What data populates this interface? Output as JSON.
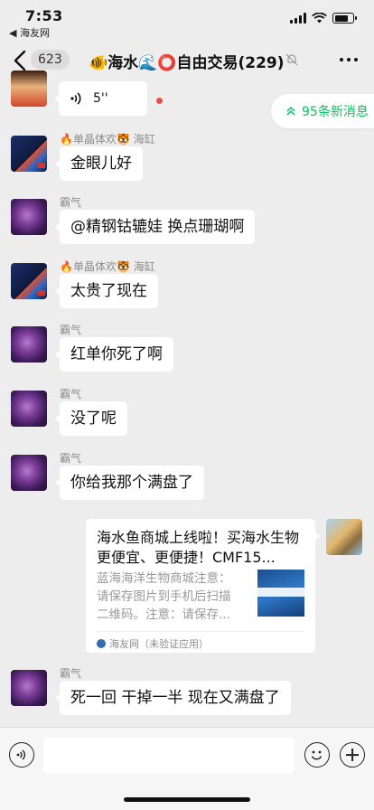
{
  "status_bar": {
    "time": "7:53",
    "back_app": "◀ 海友网"
  },
  "nav": {
    "unread_count": "623",
    "title": "🐠海水🌊⭕自由交易(229)"
  },
  "new_messages": {
    "label": "95条新消息"
  },
  "voice_message": {
    "duration": "5''"
  },
  "messages": [
    {
      "sender": "🔥单晶体欢🐯 海缸",
      "text": "金眼儿好"
    },
    {
      "sender": "霸气",
      "text": "@精钢钴辘娃 换点珊瑚啊"
    },
    {
      "sender": "🔥单晶体欢🐯 海缸",
      "text": "太贵了现在"
    },
    {
      "sender": "霸气",
      "text": "红单你死了啊"
    },
    {
      "sender": "霸气",
      "text": "没了呢"
    },
    {
      "sender": "霸气",
      "text": "你给我那个满盘了"
    },
    {
      "sender": "霸气",
      "text": "死一回 干掉一半 现在又满盘了"
    }
  ],
  "link_card": {
    "title": "海水鱼商城上线啦！买海水生物更便宜、更便捷！CMF15...",
    "description": "蓝海海洋生物商城注意：请保存图片到手机后扫描二维码。注意：请保存...",
    "source": "海友网（未验证应用）"
  },
  "input_bar": {
    "placeholder": ""
  }
}
